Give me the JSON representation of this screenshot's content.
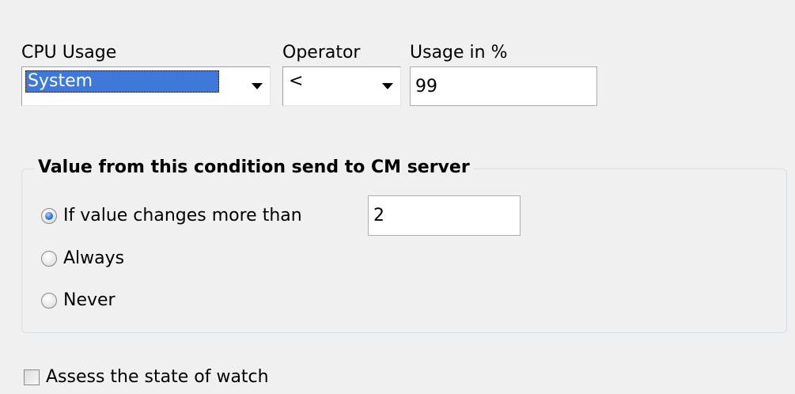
{
  "filter": {
    "cpu_usage": {
      "label": "CPU Usage",
      "value": "System"
    },
    "operator": {
      "label": "Operator",
      "value": "<"
    },
    "usage": {
      "label": "Usage in %",
      "value": "99"
    }
  },
  "send_group": {
    "title": "Value from this condition send to CM server",
    "options": [
      {
        "label": "If value changes more than",
        "checked": true
      },
      {
        "label": "Always",
        "checked": false
      },
      {
        "label": "Never",
        "checked": false
      }
    ],
    "threshold_value": "2"
  },
  "assess": {
    "label": "Assess the state of watch",
    "checked": false
  },
  "icons": {
    "dropdown": "chevron-down-icon"
  }
}
